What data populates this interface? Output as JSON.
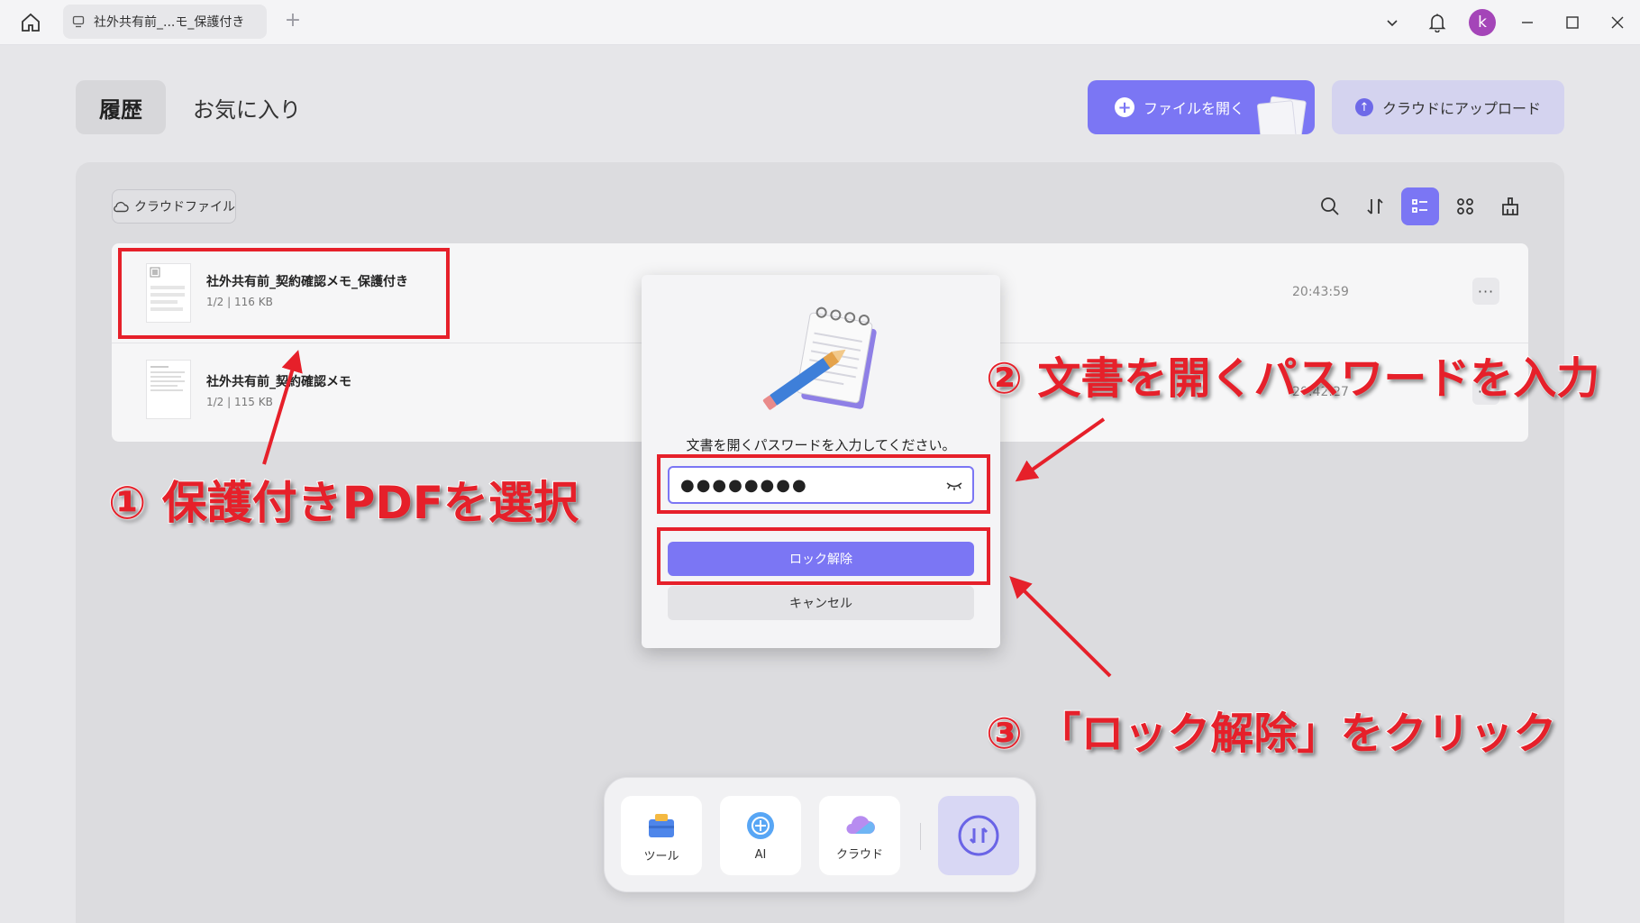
{
  "titlebar": {
    "tab_label": "社外共有前_...モ_保護付き",
    "new_tab": "+",
    "avatar_letter": "k"
  },
  "header": {
    "history": "履歴",
    "favorites": "お気に入り",
    "open_file": "ファイルを開く",
    "upload_cloud": "クラウドにアップロード"
  },
  "panel": {
    "cloud_files": "クラウドファイル",
    "files": [
      {
        "name": "社外共有前_契約確認メモ_保護付き",
        "meta": "1/2 | 116 KB",
        "time": "20:43:59"
      },
      {
        "name": "社外共有前_契約確認メモ",
        "meta": "1/2 | 115 KB",
        "time": "20:42:27"
      }
    ],
    "more": "···"
  },
  "dialog": {
    "prompt": "文書を開くパスワードを入力してください。",
    "password_value": "●●●●●●●●",
    "unlock": "ロック解除",
    "cancel": "キャンセル"
  },
  "dock": {
    "tools": "ツール",
    "ai": "AI",
    "cloud": "クラウド"
  },
  "annotations": {
    "step1": "① 保護付きPDFを選択",
    "step2": "② 文書を開くパスワードを入力",
    "step3": "③ 「ロック解除」をクリック"
  },
  "colors": {
    "accent": "#7b76f4",
    "annotation_red": "#e6202a",
    "avatar": "#a445b8"
  }
}
